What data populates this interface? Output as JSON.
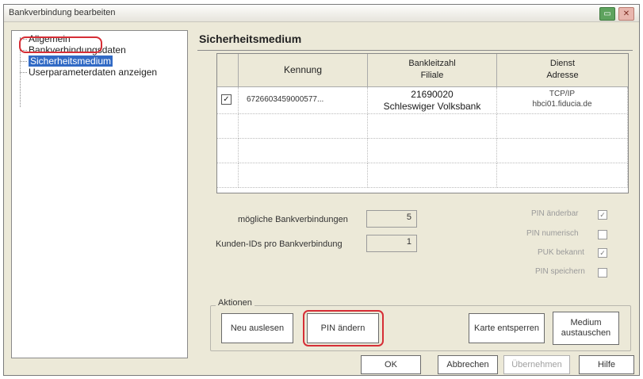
{
  "window": {
    "title": "Bankverbindung bearbeiten"
  },
  "tree": {
    "items": [
      {
        "label": "Allgemein",
        "selected": false
      },
      {
        "label": "Bankverbindungsdaten",
        "selected": false
      },
      {
        "label": "Sicherheitsmedium",
        "selected": true
      },
      {
        "label": "Userparameterdaten anzeigen",
        "selected": false
      }
    ]
  },
  "section": {
    "title": "Sicherheitsmedium"
  },
  "grid": {
    "headers": {
      "kennung": "Kennung",
      "blz_line1": "Bankleitzahl",
      "blz_line2": "Filiale",
      "dienst_line1": "Dienst",
      "dienst_line2": "Adresse"
    },
    "rows": [
      {
        "checked": true,
        "kennung": "6726603459000577...",
        "blz": "21690020",
        "filiale": "Schleswiger Volksbank",
        "dienst": "TCP/IP",
        "adresse": "hbci01.fiducia.de"
      }
    ]
  },
  "info": {
    "moegliche_label": "mögliche Bankverbindungen",
    "moegliche_value": "5",
    "kunden_label": "Kunden-IDs pro Bankverbindung",
    "kunden_value": "1"
  },
  "flags": [
    {
      "label": "PIN änderbar",
      "checked": true
    },
    {
      "label": "PIN numerisch",
      "checked": false
    },
    {
      "label": "PUK bekannt",
      "checked": true
    },
    {
      "label": "PIN speichern",
      "checked": false
    }
  ],
  "actions": {
    "group_label": "Aktionen",
    "neu_auslesen": "Neu auslesen",
    "pin_aendern": "PIN ändern",
    "karte_entsperren": "Karte entsperren",
    "medium_line1": "Medium",
    "medium_line2": "austauschen"
  },
  "footer": {
    "ok": "OK",
    "abbrechen": "Abbrechen",
    "uebernehmen": "Übernehmen",
    "hilfe": "Hilfe"
  },
  "colors": {
    "highlight": "#d62e36",
    "selection": "#316ac5",
    "dialog_bg": "#ece9d8"
  }
}
